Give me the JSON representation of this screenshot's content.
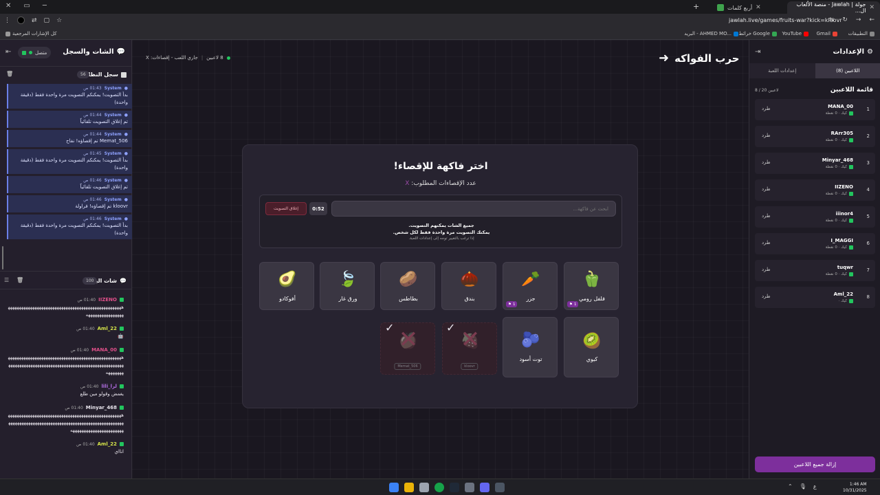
{
  "browser": {
    "window_controls": {
      "close": "✕",
      "restore": "▭",
      "minimize": "─"
    },
    "tabs": [
      {
        "label": "جولة | Jawlah - منصة الألعاب ال...",
        "active": true
      },
      {
        "label": "أربع كلمات",
        "active": false
      }
    ],
    "new_tab": "+",
    "url": "jawlah.live/games/fruits-war?kick=kloovr",
    "bookmarks": [
      {
        "label": "التطبيقات"
      },
      {
        "label": "Gmail"
      },
      {
        "label": "YouTube"
      },
      {
        "label": "خرائط Google"
      },
      {
        "label": "البريد - AHMED MO..."
      },
      {
        "label": "كل الإشارات المرجعية"
      }
    ]
  },
  "left_panel": {
    "title": "الشات والسجل",
    "connection": "متصل",
    "system_log": {
      "title": "سجل النظام",
      "count": "56",
      "entries": [
        {
          "name": "System",
          "time": "01:43 ص",
          "text": "بدأ التصويت! يمكنكم التصويت مرة واحدة فقط (دقيقة واحدة)"
        },
        {
          "name": "System",
          "time": "01:44 ص",
          "text": "تم إغلاق التصويت تلقائياً"
        },
        {
          "name": "System",
          "time": "01:44 ص",
          "text": "Memat_506 تم إقصاؤه! نفاح"
        },
        {
          "name": "System",
          "time": "01:45 ص",
          "text": "بدأ التصويت! يمكنكم التصويت مرة واحدة فقط (دقيقة واحدة)"
        },
        {
          "name": "System",
          "time": "01:46 ص",
          "text": "تم إغلاق التصويت تلقائياً"
        },
        {
          "name": "System",
          "time": "01:46 ص",
          "text": "kloovr تم إقصاؤه! فراولة"
        },
        {
          "name": "System",
          "time": "01:46 ص",
          "text": "بدأ التصويت! يمكنكم التصويت مرة واحدة فقط (دقيقة واحدة)"
        }
      ]
    },
    "live_chat": {
      "title": "شات البث",
      "count": "100",
      "messages": [
        {
          "name": "IIZENO",
          "time": "01:40 ص",
          "color": "#e0508a",
          "text": "ههههههههههههههههههههههههههههههههههههههههههههههههههههههههههههههههههههه"
        },
        {
          "name": "Aml_22",
          "time": "01:40 ص",
          "color": "#d7e64a",
          "text": "🤖"
        },
        {
          "name": "MANA_00",
          "time": "01:40 ص",
          "color": "#e0508a",
          "text": "هههههههههههههههههههههههههههههههههههههههههههههههههههههههههههههههههههههههههههههههههههههههههههههههههههههههههههههههه"
        },
        {
          "name": "لرا_lili",
          "time": "01:40 ص",
          "color": "#b06de0",
          "text": "يغمض وقولو مين طلع"
        },
        {
          "name": "Minyar_468",
          "time": "01:40 ص",
          "color": "#e8e4ec",
          "text": "هههههههههههههههههههههههههههههههههههههههههههههههههههههههههههههههههههههههههههههههههههههههههههههههههههههههههههههههههههههههههههههههه"
        },
        {
          "name": "Aml_22",
          "time": "01:40 ص",
          "color": "#d7e64a",
          "text": "انااي"
        }
      ]
    }
  },
  "header": {
    "back_title": "حرب الفواكه",
    "status": "جاري اللعب - إقصاءات: X",
    "player_count": "8 لاعبين"
  },
  "vote_card": {
    "title": "اختر فاكهة للإقصاء!",
    "subtitle": "عدد الإقصاءات المطلوب:",
    "subtitle_value": "X",
    "search_placeholder": "ابحث عن فاكهة...",
    "timer": "0:52",
    "close_vote": "إغلاق التصويت",
    "info_line1": "جميع الشات يمكنهم التصويت.",
    "info_line2": "يمكنك التصويت مرة واحدة فقط لكل شخص.",
    "info_line3": "إذا ترغب بالتغيير توجه إلى إعدادات اللعبة.",
    "fruits": [
      {
        "name": "فلفل رومي",
        "icon": "🫑",
        "votes": "1",
        "eliminated": false
      },
      {
        "name": "جزر",
        "icon": "🥕",
        "votes": "1",
        "eliminated": false
      },
      {
        "name": "بندق",
        "icon": "🌰",
        "votes": "",
        "eliminated": false
      },
      {
        "name": "بطاطس",
        "icon": "🥔",
        "votes": "",
        "eliminated": false
      },
      {
        "name": "ورق غار",
        "icon": "🍃",
        "votes": "",
        "eliminated": false
      },
      {
        "name": "أفوكادو",
        "icon": "🥑",
        "votes": "",
        "eliminated": false
      },
      {
        "name": "كيوي",
        "icon": "🥝",
        "votes": "",
        "eliminated": false
      },
      {
        "name": "توت أسود",
        "icon": "🫐",
        "votes": "",
        "eliminated": false
      },
      {
        "name": "فراولة",
        "icon": "🍓",
        "votes": "",
        "eliminated": true,
        "eliminated_by": "kloovr"
      },
      {
        "name": "تفاح",
        "icon": "🍎",
        "votes": "",
        "eliminated": true,
        "eliminated_by": "Memat_506"
      }
    ]
  },
  "right_panel": {
    "title": "الإعدادات",
    "tabs": [
      {
        "label": "اللاعبين (8)",
        "active": true
      },
      {
        "label": "إعدادات اللعبة",
        "active": false
      }
    ],
    "players_title": "قائمة اللاعبين",
    "players_count": "8 / 20 لاعبين",
    "kick_label": "طرد",
    "players": [
      {
        "num": "1",
        "name": "MANA_00",
        "stat": "كيك · 0 نقطة"
      },
      {
        "num": "2",
        "name": "RArr305",
        "stat": "كيك · 0 نقطة"
      },
      {
        "num": "3",
        "name": "Minyar_468",
        "stat": "كيك · 0 نقطة"
      },
      {
        "num": "4",
        "name": "IIZENO",
        "stat": "كيك · 0 نقطة"
      },
      {
        "num": "5",
        "name": "iiinor4",
        "stat": "كيك · 0 نقطة"
      },
      {
        "num": "6",
        "name": "I_MAGGI",
        "stat": "كيك · 0 نقطة"
      },
      {
        "num": "7",
        "name": "tuqwr",
        "stat": "كيك · 0 نقطة"
      },
      {
        "num": "8",
        "name": "Aml_22",
        "stat": "كيك ·"
      }
    ],
    "remove_all": "إزالة جميع اللاعبين"
  },
  "taskbar": {
    "time": "1:46 AM",
    "date": "10/31/2025",
    "lang": "ع"
  },
  "colors": {
    "accent": "#7d2f9c",
    "online": "#22c55e",
    "log_bg": "#2b2f52"
  }
}
